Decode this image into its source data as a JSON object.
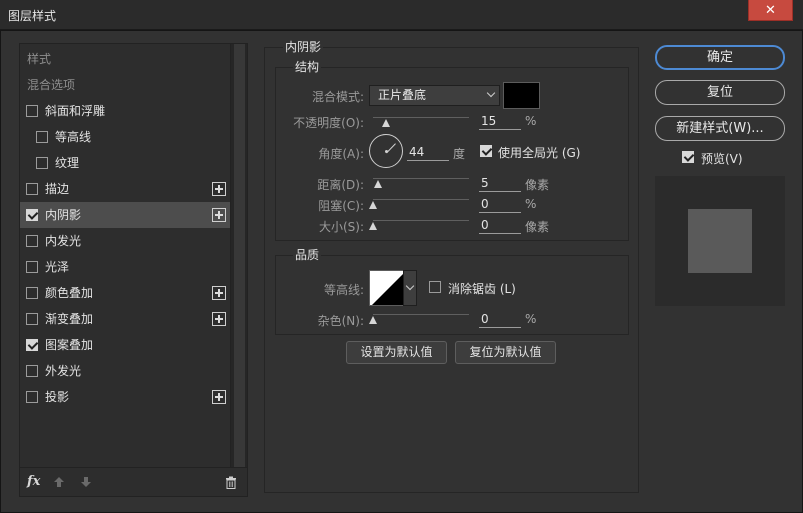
{
  "window": {
    "title": "图层样式",
    "close_glyph": "✕"
  },
  "style_list": {
    "header_styles": "样式",
    "header_blending": "混合选项",
    "items": [
      {
        "label": "斜面和浮雕",
        "checked": false,
        "has_plus": false,
        "indent": false
      },
      {
        "label": "等高线",
        "checked": false,
        "has_plus": false,
        "indent": true
      },
      {
        "label": "纹理",
        "checked": false,
        "has_plus": false,
        "indent": true
      },
      {
        "label": "描边",
        "checked": false,
        "has_plus": true,
        "indent": false
      },
      {
        "label": "内阴影",
        "checked": true,
        "has_plus": true,
        "indent": false,
        "selected": true
      },
      {
        "label": "内发光",
        "checked": false,
        "has_plus": false,
        "indent": false
      },
      {
        "label": "光泽",
        "checked": false,
        "has_plus": false,
        "indent": false
      },
      {
        "label": "颜色叠加",
        "checked": false,
        "has_plus": true,
        "indent": false
      },
      {
        "label": "渐变叠加",
        "checked": false,
        "has_plus": true,
        "indent": false
      },
      {
        "label": "图案叠加",
        "checked": true,
        "has_plus": false,
        "indent": false
      },
      {
        "label": "外发光",
        "checked": false,
        "has_plus": false,
        "indent": false
      },
      {
        "label": "投影",
        "checked": false,
        "has_plus": true,
        "indent": false
      }
    ],
    "footer": {
      "fx_label": "fx",
      "icons": [
        "move-up-icon",
        "move-down-icon",
        "trash-icon"
      ]
    }
  },
  "panel": {
    "title": "内阴影",
    "structure": {
      "title": "结构",
      "blend_mode_label": "混合模式:",
      "blend_mode_value": "正片叠底",
      "shadow_color": "#000000",
      "opacity_label": "不透明度(O):",
      "opacity_value": "15",
      "opacity_unit": "%",
      "opacity_fraction": 0.15,
      "angle_label": "角度(A):",
      "angle_value": "44",
      "angle_unit": "度",
      "global_light_label": "使用全局光 (G)",
      "global_light_checked": true,
      "distance_label": "距离(D):",
      "distance_value": "5",
      "distance_unit": "像素",
      "choke_label": "阻塞(C):",
      "choke_value": "0",
      "choke_unit": "%",
      "size_label": "大小(S):",
      "size_value": "0",
      "size_unit": "像素"
    },
    "quality": {
      "title": "品质",
      "contour_label": "等高线:",
      "antialias_label": "消除锯齿 (L)",
      "antialias_checked": false,
      "noise_label": "杂色(N):",
      "noise_value": "0",
      "noise_unit": "%"
    },
    "buttons": {
      "set_default": "设置为默认值",
      "reset_default": "复位为默认值"
    }
  },
  "right": {
    "ok": "确定",
    "reset": "复位",
    "new_style": "新建样式(W)...",
    "preview_label": "预览(V)",
    "preview_checked": true
  },
  "colors": {
    "accent": "#4d8ad4",
    "close": "#c74a3f"
  }
}
